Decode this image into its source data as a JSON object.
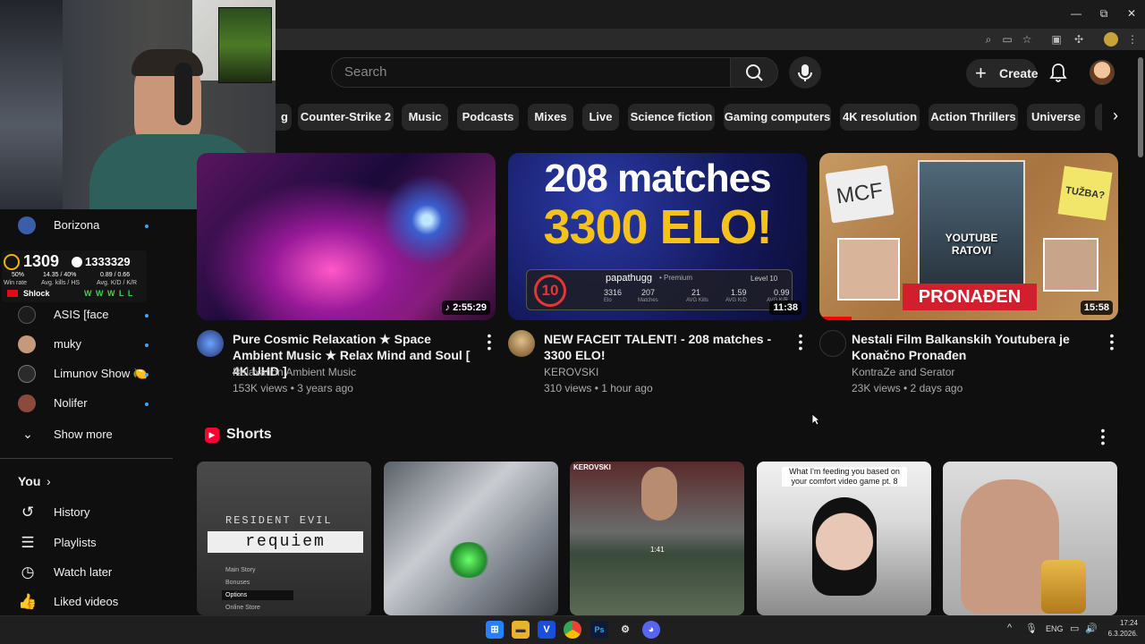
{
  "browser": {
    "minimize": "—",
    "restore": "⧉",
    "close": "✕"
  },
  "header": {
    "search_placeholder": "Search",
    "create_label": "Create"
  },
  "chips": [
    {
      "label": "g"
    },
    {
      "label": "Counter-Strike 2"
    },
    {
      "label": "Music"
    },
    {
      "label": "Podcasts"
    },
    {
      "label": "Mixes"
    },
    {
      "label": "Live"
    },
    {
      "label": "Science fiction"
    },
    {
      "label": "Gaming computers"
    },
    {
      "label": "4K resolution"
    },
    {
      "label": "Action Thrillers"
    },
    {
      "label": "Universe"
    }
  ],
  "sidebar": {
    "channels": [
      {
        "name": "Borizona"
      },
      {
        "name": "ASIS [face"
      },
      {
        "name": "muky"
      },
      {
        "name": "Limunov Show 🍋"
      },
      {
        "name": "Nolifer"
      }
    ],
    "show_more": "Show more",
    "you_label": "You",
    "you_items": [
      {
        "label": "History"
      },
      {
        "label": "Playlists"
      },
      {
        "label": "Watch later"
      },
      {
        "label": "Liked videos"
      }
    ]
  },
  "stats_overlay": {
    "elo": "1309",
    "rank_points": "1333329",
    "winrate_val": "50%",
    "winrate_label": "Win rate",
    "kills_val": "14.35 / 40%",
    "kills_label": "Avg. kills / HS",
    "kd_val": "0.89 / 0.66",
    "kd_label": "Avg. K/D / K/R",
    "player": "Shlock",
    "form": "W W W L L"
  },
  "videos": [
    {
      "title": "Pure Cosmic Relaxation ★ Space Ambient Music ★ Relax Mind and Soul [ 4K UHD ]",
      "channel": "Relaxation Ambient Music",
      "meta": "153K views • 3 years ago",
      "duration": "♪ 2:55:29"
    },
    {
      "title": "NEW FACEIT TALENT! - 208 matches - 3300 ELO!",
      "channel": "KEROVSKI",
      "meta": "310 views • 1 hour ago",
      "duration": "11:38",
      "thumb_line1": "208 matches",
      "thumb_line2": "3300 ELO!",
      "thumb_level": "10",
      "thumb_player": "papathugg",
      "thumb_premium": "• Premium",
      "thumb_levellabel": "Level 10",
      "thumb_stats": [
        "3316",
        "207",
        "21",
        "1.59",
        "0.99"
      ],
      "thumb_statlabels": [
        "Elo",
        "Matches",
        "AVG Kills",
        "AVG K/D",
        "AVG K/R"
      ]
    },
    {
      "title": "Nestali Film Balkanskih Youtubera je Konačno Pronađen",
      "channel": "KontraZe and Serator",
      "meta": "23K views • 2 days ago",
      "duration": "15:58",
      "thumb_mcf": "MCF",
      "thumb_tuzba": "TUŽBA?",
      "thumb_yt": "YOUTUBE RATOVI",
      "thumb_found": "PRONAĐEN"
    }
  ],
  "shorts": {
    "title": "Shorts",
    "items": [
      {
        "line1": "RESIDENT EVIL",
        "line2": "requiem",
        "menu": [
          "Main Story",
          "Bonuses",
          "Options",
          "Online Store"
        ]
      },
      {},
      {
        "tag": "KEROVSKI",
        "time": "1:41"
      },
      {
        "caption": "What I'm feeding you based on your comfort video game pt. 8"
      },
      {}
    ]
  },
  "taskbar": {
    "lang": "ENG",
    "time": "17:24",
    "date": "6.3.2026."
  }
}
